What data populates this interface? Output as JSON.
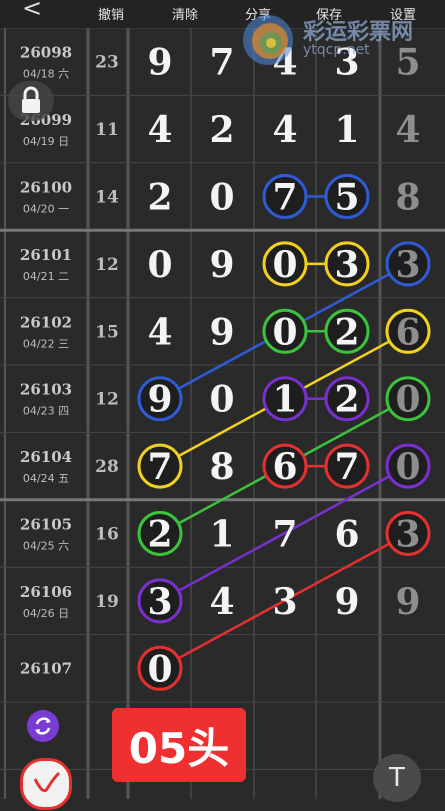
{
  "toolbar": {
    "back_icon": "back-arrow-icon",
    "undo": "撤销",
    "clear": "清除",
    "share": "分享",
    "save": "保存",
    "settings": "设置"
  },
  "logo": {
    "text": "彩运彩票网",
    "url": "ytqcp.net"
  },
  "rows": [
    {
      "issue": "26098",
      "date": "04/18 六",
      "sum": "23",
      "digits": [
        "9",
        "7",
        "4",
        "3"
      ],
      "tail": "5"
    },
    {
      "issue": "26099",
      "date": "04/19 日",
      "sum": "11",
      "digits": [
        "4",
        "2",
        "4",
        "1"
      ],
      "tail": "4"
    },
    {
      "issue": "26100",
      "date": "04/20 一",
      "sum": "14",
      "digits": [
        "2",
        "0",
        "7",
        "5"
      ],
      "tail": "8"
    },
    {
      "issue": "26101",
      "date": "04/21 二",
      "sum": "12",
      "digits": [
        "0",
        "9",
        "0",
        "3"
      ],
      "tail": "3"
    },
    {
      "issue": "26102",
      "date": "04/22 三",
      "sum": "15",
      "digits": [
        "4",
        "9",
        "0",
        "2"
      ],
      "tail": "6"
    },
    {
      "issue": "26103",
      "date": "04/23 四",
      "sum": "12",
      "digits": [
        "9",
        "0",
        "1",
        "2"
      ],
      "tail": "0"
    },
    {
      "issue": "26104",
      "date": "04/24 五",
      "sum": "28",
      "digits": [
        "7",
        "8",
        "6",
        "7"
      ],
      "tail": "0"
    },
    {
      "issue": "26105",
      "date": "04/25 六",
      "sum": "16",
      "digits": [
        "2",
        "1",
        "7",
        "6"
      ],
      "tail": "3"
    },
    {
      "issue": "26106",
      "date": "04/26 日",
      "sum": "19",
      "digits": [
        "3",
        "4",
        "3",
        "9"
      ],
      "tail": "9"
    },
    {
      "issue": "26107",
      "date": "",
      "sum": "",
      "digits": [
        "0",
        "",
        "",
        ""
      ],
      "tail": ""
    }
  ],
  "badge": "05头",
  "text_tool": "T",
  "colors": {
    "blue": "#2f5bd6",
    "yellow": "#f0d020",
    "green": "#3cc23c",
    "purple": "#7a2fd0",
    "red": "#e53030"
  },
  "icons": {
    "lock": "lock-icon",
    "refresh": "refresh-icon",
    "pen": "pen-icon",
    "text": "text-tool-icon"
  }
}
